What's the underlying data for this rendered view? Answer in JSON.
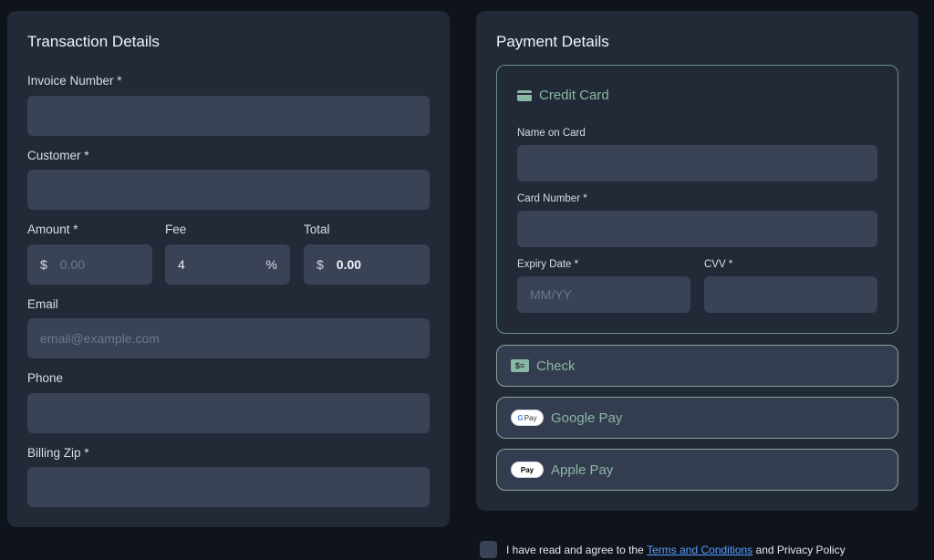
{
  "transaction": {
    "title": "Transaction Details",
    "invoice_label": "Invoice Number *",
    "invoice_value": "",
    "customer_label": "Customer *",
    "customer_value": "",
    "amount_label": "Amount *",
    "amount_prefix": "$",
    "amount_placeholder": "0.00",
    "fee_label": "Fee",
    "fee_value": "4",
    "fee_suffix": "%",
    "total_label": "Total",
    "total_prefix": "$",
    "total_value": "0.00",
    "email_label": "Email",
    "email_placeholder": "email@example.com",
    "phone_label": "Phone",
    "phone_value": "",
    "zip_label": "Billing Zip *",
    "zip_value": ""
  },
  "payment": {
    "title": "Payment Details",
    "credit_card": {
      "label": "Credit Card",
      "icon": "credit-card-icon",
      "name_label": "Name on Card",
      "number_label": "Card Number *",
      "expiry_label": "Expiry Date *",
      "expiry_placeholder": "MM/YY",
      "cvv_label": "CVV *"
    },
    "check": {
      "label": "Check",
      "icon": "check-icon"
    },
    "google_pay": {
      "label": "Google Pay",
      "badge_g": "G",
      "badge_text": "Pay"
    },
    "apple_pay": {
      "label": "Apple Pay",
      "badge_apple": "",
      "badge_text": "Pay"
    }
  },
  "terms": {
    "prefix": "I have read and agree to the",
    "link": "Terms and Conditions",
    "suffix": "and Privacy Policy"
  },
  "colors": {
    "background": "#0f131c",
    "panel": "#222a38",
    "input": "#3a4256",
    "accent": "#89b7a3",
    "link": "#5aa0ff"
  }
}
